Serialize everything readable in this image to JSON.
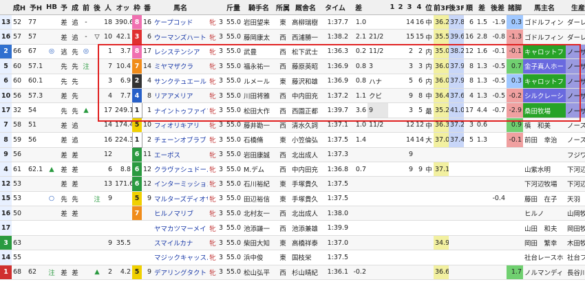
{
  "headers": [
    "成H",
    "予H",
    "HB",
    "予",
    "成",
    "前",
    "後",
    "人",
    "オッ",
    "枠",
    "番",
    "馬名",
    "",
    "斤量",
    "騎手名",
    "所属",
    "厩舎名",
    "タイム",
    "差",
    "",
    "1",
    "2",
    "3",
    "4",
    "位",
    "前3F",
    "後3F",
    "順",
    "差",
    "後差",
    "諸脚",
    "馬主名",
    "生産者名"
  ],
  "rows": [
    {
      "no": "13",
      "h": "52",
      "yh": "77",
      "hb": "",
      "yo": "差",
      "sei": "追",
      "zen": "-",
      "go": "",
      "nin": "18",
      "odds": "390.6",
      "waku": "8",
      "ban": "16",
      "name": "ケープコッド",
      "sex": "牝",
      "age": "3",
      "kin": "55.0",
      "jockey": "岩田望来",
      "sho": "東",
      "trainer": "高柳瑞樹",
      "time": "1:37.7",
      "sa": "1.0",
      "chaku": "",
      "c1": "",
      "c2": "",
      "c3": "14",
      "c4": "16",
      "pos": "中",
      "f3": "36.2",
      "l3": "37.8",
      "rank": "6",
      "diff": "1.5",
      "godiff": "-1.9",
      "legs": "0.3",
      "owner": "ゴドルフィン",
      "breeder": "ダーレー・ジ"
    },
    {
      "no": "16",
      "h": "57",
      "yh": "57",
      "hb": "",
      "yo": "差",
      "sei": "追",
      "zen": "-",
      "go": "▽",
      "nin": "10",
      "odds": "42.1",
      "waku": "3",
      "ban": "6",
      "name": "ウーマンズハート",
      "sex": "牝",
      "age": "3",
      "kin": "55.0",
      "jockey": "藤岡康太",
      "sho": "西",
      "trainer": "西浦勝一",
      "time": "1:38.2",
      "sa": "2.1",
      "chaku": "21/2",
      "c1": "",
      "c2": "",
      "c3": "15",
      "c4": "15",
      "pos": "中",
      "f3": "35.5",
      "l3": "39.6",
      "rank": "16",
      "diff": "2.8",
      "godiff": "-0.8",
      "legs": "-1.3",
      "owner": "ゴドルフィン",
      "breeder": "ダーレー・ジ"
    },
    {
      "no": "2",
      "h": "66",
      "yh": "67",
      "hb": "◎",
      "yo": "逃",
      "sei": "先",
      "zen": "◎",
      "go": "",
      "nin": "1",
      "odds": "3.7",
      "waku": "8",
      "ban": "17",
      "name": "レシステンシア",
      "sex": "牝",
      "age": "3",
      "kin": "55.0",
      "jockey": "武豊",
      "sho": "西",
      "trainer": "松下武士",
      "time": "1:36.3",
      "sa": "0.2",
      "chaku": "11/2",
      "c1": "",
      "c2": "",
      "c3": "2",
      "c4": "2",
      "pos": "内",
      "f3": "35.0",
      "l3": "38.2",
      "rank": "12",
      "diff": "1.6",
      "godiff": "-0.1",
      "legs": "-0.1",
      "owner": "キャロットフ",
      "breeder": "ノーザンファ"
    },
    {
      "no": "5",
      "h": "60",
      "yh": "57.1",
      "hb": "",
      "yo": "先",
      "sei": "先",
      "zen": "注",
      "go": "",
      "nin": "7",
      "odds": "10.4",
      "waku": "7",
      "ban": "14",
      "name": "ミヤマザクラ",
      "sex": "牝",
      "age": "3",
      "kin": "55.0",
      "jockey": "福永祐一",
      "sho": "西",
      "trainer": "藤原英昭",
      "time": "1:36.9",
      "sa": "0.8",
      "chaku": "3",
      "c1": "",
      "c2": "",
      "c3": "3",
      "c4": "3",
      "pos": "内",
      "f3": "36.0",
      "l3": "37.9",
      "rank": "8",
      "diff": "1.3",
      "godiff": "-0.5",
      "legs": "0.7",
      "owner": "金子真人ホー",
      "breeder": "ノーザンファ"
    },
    {
      "no": "6",
      "h": "60",
      "yh": "60.1",
      "hb": "",
      "yo": "先",
      "sei": "先",
      "zen": "",
      "go": "",
      "nin": "3",
      "odds": "6.9",
      "waku": "2",
      "ban": "4",
      "name": "サンクテュエール",
      "sex": "牝",
      "age": "3",
      "kin": "55.0",
      "jockey": "ルメール",
      "sho": "東",
      "trainer": "藤沢和雄",
      "time": "1:36.9",
      "sa": "0.8",
      "chaku": "ハナ",
      "c1": "",
      "c2": "",
      "c3": "5",
      "c4": "6",
      "pos": "内",
      "f3": "36.0",
      "l3": "37.9",
      "rank": "8",
      "diff": "1.3",
      "godiff": "-0.5",
      "legs": "0.3",
      "owner": "キャロットフ",
      "breeder": "ノーザンファ"
    },
    {
      "no": "10",
      "h": "56",
      "yh": "57.3",
      "hb": "",
      "yo": "差",
      "sei": "先",
      "zen": "",
      "go": "",
      "nin": "4",
      "odds": "7.7",
      "waku": "4",
      "ban": "8",
      "name": "リアアメリア",
      "sex": "牝",
      "age": "3",
      "kin": "55.0",
      "jockey": "川田将雅",
      "sho": "西",
      "trainer": "中内田充",
      "time": "1:37.2",
      "sa": "1.1",
      "chaku": "クビ",
      "c1": "",
      "c2": "",
      "c3": "9",
      "c4": "8",
      "pos": "中",
      "f3": "36.4",
      "l3": "37.6",
      "rank": "4",
      "diff": "1.3",
      "godiff": "-0.5",
      "legs": "-0.2",
      "owner": "シルクレーシ",
      "breeder": "ノーザンファ"
    },
    {
      "no": "17",
      "h": "32",
      "yh": "54",
      "hb": "",
      "yo": "先",
      "sei": "先",
      "zen": "▲",
      "go": "",
      "nin": "17",
      "odds": "249.1",
      "waku": "1",
      "ban": "1",
      "name": "ナイントゥファイブ",
      "sex": "牝",
      "age": "3",
      "kin": "55.0",
      "jockey": "松田大作",
      "sho": "西",
      "trainer": "西園正都",
      "time": "1:39.7",
      "sa": "3.6",
      "chaku": "9",
      "c1": "",
      "c2": "",
      "c3": "3",
      "c4": "5",
      "pos": "最",
      "f3": "35.2",
      "l3": "41.0",
      "rank": "17",
      "diff": "4.4",
      "godiff": "-0.7",
      "legs": "-2.9",
      "owner": "桑田牧場",
      "breeder": "ノーザンファ"
    },
    {
      "no": "7",
      "h": "58",
      "yh": "51",
      "hb": "",
      "yo": "差",
      "sei": "追",
      "zen": "",
      "go": "",
      "nin": "14",
      "odds": "174.4",
      "waku": "5",
      "ban": "10",
      "name": "フィオリキアリ",
      "sex": "牝",
      "age": "3",
      "kin": "55.0",
      "jockey": "藤井勘一",
      "sho": "西",
      "trainer": "清水久詞",
      "time": "1:37.1",
      "sa": "1.0",
      "chaku": "11/2",
      "c1": "",
      "c2": "",
      "c3": "12",
      "c4": "12",
      "pos": "中",
      "f3": "36.3",
      "l3": "37.2",
      "rank": "3",
      "diff": "0.6",
      "godiff": "",
      "legs": "0.9",
      "owner": "槙　和美",
      "breeder": "ノースヒルズ"
    },
    {
      "no": "8",
      "h": "59",
      "yh": "56",
      "hb": "",
      "yo": "差",
      "sei": "追",
      "zen": "",
      "go": "",
      "nin": "16",
      "odds": "224.3",
      "waku": "1",
      "ban": "2",
      "name": "チェーンオブラブ",
      "sex": "牝",
      "age": "3",
      "kin": "55.0",
      "jockey": "石橋脩",
      "sho": "東",
      "trainer": "小笠倫弘",
      "time": "1:37.5",
      "sa": "1.4",
      "chaku": "",
      "c1": "",
      "c2": "",
      "c3": "14",
      "c4": "14",
      "pos": "大",
      "f3": "37.0",
      "l3": "37.4",
      "rank": "5",
      "diff": "1.3",
      "godiff": "",
      "legs": "-0.1",
      "owner": "前田　幸治",
      "breeder": "ノースヒルズ"
    },
    {
      "no": "9",
      "h": "56",
      "yh": "",
      "hb": "",
      "yo": "差",
      "sei": "差",
      "zen": "",
      "go": "",
      "nin": "12",
      "odds": "",
      "waku": "6",
      "ban": "11",
      "name": "エーポス",
      "sex": "牝",
      "age": "3",
      "kin": "55.0",
      "jockey": "岩田康誠",
      "sho": "西",
      "trainer": "北出成人",
      "time": "1:37.3",
      "sa": "",
      "chaku": "",
      "c1": "",
      "c2": "",
      "c3": "9",
      "c4": "",
      "pos": "",
      "f3": "",
      "l3": "",
      "rank": "",
      "diff": "",
      "godiff": "",
      "legs": "",
      "owner": "",
      "breeder": "フジワラ・フ"
    },
    {
      "no": "4",
      "h": "61",
      "yh": "62.1",
      "hb": "▲",
      "yo": "差",
      "sei": "差",
      "zen": "",
      "go": "",
      "nin": "6",
      "odds": "8.8",
      "waku": "6",
      "ban": "12",
      "name": "クラヴァシュドール",
      "sex": "牝",
      "age": "3",
      "kin": "55.0",
      "jockey": "M.デム",
      "sho": "西",
      "trainer": "中内田充",
      "time": "1:36.8",
      "sa": "0.7",
      "chaku": "",
      "c1": "",
      "c2": "",
      "c3": "9",
      "c4": "9",
      "pos": "中",
      "f3": "37.1",
      "l3": "",
      "rank": "",
      "diff": "",
      "godiff": "",
      "legs": "",
      "owner": "山紫水明",
      "breeder": "下河辺牧場"
    },
    {
      "no": "12",
      "h": "53",
      "yh": "",
      "hb": "",
      "yo": "差",
      "sei": "差",
      "zen": "",
      "go": "",
      "nin": "13",
      "odds": "171.6",
      "waku": "6",
      "ban": "12",
      "name": "インターミッション",
      "sex": "牝",
      "age": "3",
      "kin": "55.0",
      "jockey": "石川裕紀",
      "sho": "東",
      "trainer": "手塚貴久",
      "time": "1:37.5",
      "sa": "",
      "chaku": "",
      "c1": "",
      "c2": "",
      "c3": "",
      "c4": "",
      "pos": "",
      "f3": "",
      "l3": "",
      "rank": "",
      "diff": "",
      "godiff": "",
      "legs": "",
      "owner": "下河辺牧場",
      "breeder": "下河辺牧場"
    },
    {
      "no": "15",
      "h": "53",
      "yh": "",
      "hb": "○",
      "yo": "先",
      "sei": "先",
      "zen": "",
      "go": "注",
      "nin": "9",
      "odds": "",
      "waku": "5",
      "ban": "9",
      "name": "マルターズディオサ",
      "sex": "牝",
      "age": "3",
      "kin": "55.0",
      "jockey": "田辺裕信",
      "sho": "東",
      "trainer": "手塚貴久",
      "time": "1:37.5",
      "sa": "",
      "chaku": "",
      "c1": "",
      "c2": "",
      "c3": "",
      "c4": "",
      "pos": "",
      "f3": "",
      "l3": "",
      "rank": "",
      "diff": "",
      "godiff": "-0.4",
      "legs": "",
      "owner": "藤田　在子",
      "breeder": "天羽　禮治"
    },
    {
      "no": "16",
      "h": "50",
      "yh": "",
      "hb": "",
      "yo": "差",
      "sei": "差",
      "zen": "",
      "go": "",
      "nin": "",
      "odds": "",
      "waku": "7",
      "ban": "",
      "name": "ヒルノマリブ",
      "sex": "牝",
      "age": "3",
      "kin": "55.0",
      "jockey": "北村友一",
      "sho": "西",
      "trainer": "北出成人",
      "time": "1:38.0",
      "sa": "",
      "chaku": "",
      "c1": "",
      "c2": "",
      "c3": "",
      "c4": "",
      "pos": "",
      "f3": "",
      "l3": "",
      "rank": "",
      "diff": "",
      "godiff": "",
      "legs": "",
      "owner": "ヒルノ",
      "breeder": "山岡牧場"
    },
    {
      "no": "17",
      "h": "",
      "yh": "",
      "hb": "",
      "yo": "",
      "sei": "",
      "zen": "",
      "go": "",
      "nin": "",
      "odds": "",
      "waku": "",
      "ban": "",
      "name": "ヤマカツマーメイド",
      "sex": "牝",
      "age": "3",
      "kin": "55.0",
      "jockey": "池添謙一",
      "sho": "西",
      "trainer": "池添兼雄",
      "time": "1:39.9",
      "sa": "",
      "chaku": "",
      "c1": "",
      "c2": "",
      "c3": "",
      "c4": "",
      "pos": "",
      "f3": "",
      "l3": "",
      "rank": "",
      "diff": "",
      "godiff": "",
      "legs": "",
      "owner": "山田　和夫",
      "breeder": "岡田牧場"
    },
    {
      "no": "3",
      "h": "63",
      "yh": "",
      "hb": "",
      "yo": "",
      "sei": "",
      "zen": "",
      "go": "",
      "nin": "9",
      "odds": "35.5",
      "waku": "",
      "ban": "",
      "name": "スマイルカナ",
      "sex": "牝",
      "age": "3",
      "kin": "55.0",
      "jockey": "柴田大知",
      "sho": "東",
      "trainer": "高橋祥泰",
      "time": "1:37.0",
      "sa": "",
      "chaku": "",
      "c1": "",
      "c2": "",
      "c3": "",
      "c4": "",
      "pos": "",
      "f3": "34.9",
      "l3": "",
      "rank": "",
      "diff": "",
      "godiff": "",
      "legs": "",
      "owner": "岡田　繁幸",
      "breeder": "木田牧場"
    },
    {
      "no": "14",
      "h": "55",
      "yh": "",
      "hb": "",
      "yo": "",
      "sei": "",
      "zen": "",
      "go": "",
      "nin": "",
      "odds": "",
      "waku": "",
      "ban": "",
      "name": "マジックキャッスル",
      "sex": "牝",
      "age": "3",
      "kin": "55.0",
      "jockey": "浜中俊",
      "sho": "東",
      "trainer": "国枝栄",
      "time": "1:37.5",
      "sa": "",
      "chaku": "",
      "c1": "",
      "c2": "",
      "c3": "",
      "c4": "",
      "pos": "",
      "f3": "",
      "l3": "",
      "rank": "",
      "diff": "",
      "godiff": "",
      "legs": "",
      "owner": "社台レースホ",
      "breeder": "社台ファーム"
    },
    {
      "no": "1",
      "h": "68",
      "yh": "62",
      "hb": "注",
      "yo": "差",
      "sei": "差",
      "zen": "",
      "go": "▲",
      "nin": "2",
      "odds": "4.2",
      "waku": "5",
      "ban": "9",
      "name": "デアリングタクト",
      "sex": "牝",
      "age": "3",
      "kin": "55.0",
      "jockey": "松山弘平",
      "sho": "西",
      "trainer": "杉山晴紀",
      "time": "1:36.1",
      "sa": "-0.2",
      "chaku": "",
      "c1": "",
      "c2": "",
      "c3": "",
      "c4": "",
      "pos": "",
      "f3": "36.6",
      "l3": "",
      "rank": "",
      "diff": "",
      "godiff": "",
      "legs": "1.7",
      "owner": "ノルマンディ",
      "breeder": "長谷川牧場"
    }
  ]
}
